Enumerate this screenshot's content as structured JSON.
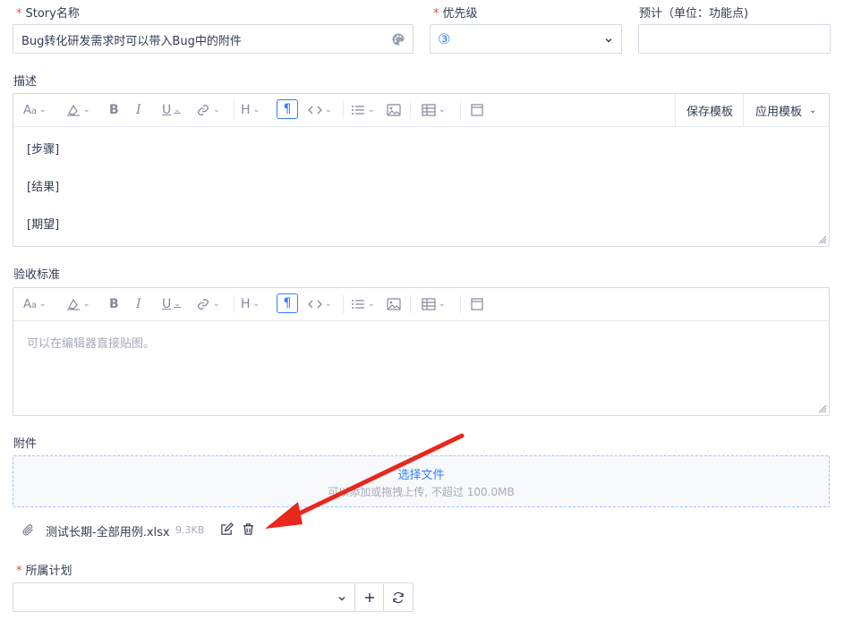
{
  "fields": {
    "story_name": {
      "label": "Story名称",
      "value": "Bug转化研发需求时可以带入Bug中的附件"
    },
    "priority": {
      "label": "优先级",
      "value": "③"
    },
    "estimate": {
      "label": "预计（单位：功能点)",
      "value": ""
    },
    "description": {
      "label": "描述",
      "lines": [
        "[步骤]",
        "[结果]",
        "[期望]"
      ],
      "save_template": "保存模板",
      "apply_template": "应用模板"
    },
    "acceptance": {
      "label": "验收标准",
      "placeholder": "可以在编辑器直接贴图。"
    },
    "attachments": {
      "label": "附件",
      "select_file": "选择文件",
      "hint": "可以添加或拖拽上传, 不超过 100.0MB",
      "file": {
        "name": "测试长期-全部用例.xlsx",
        "size": "9.3KB"
      }
    },
    "plan": {
      "label": "所属计划",
      "value": ""
    }
  },
  "colors": {
    "accent": "#2e7fff",
    "required": "#e74c3c",
    "arrow": "#e8271d"
  },
  "icons": [
    "palette-icon",
    "chevron-down-icon",
    "font-icon",
    "paint-icon",
    "bold-icon",
    "italic-icon",
    "underline-icon",
    "link-icon",
    "heading-icon",
    "paragraph-icon",
    "code-icon",
    "list-icon",
    "image-icon",
    "table-icon",
    "window-icon",
    "paperclip-icon",
    "edit-icon",
    "trash-icon",
    "plus-icon",
    "refresh-icon",
    "red-arrow"
  ]
}
